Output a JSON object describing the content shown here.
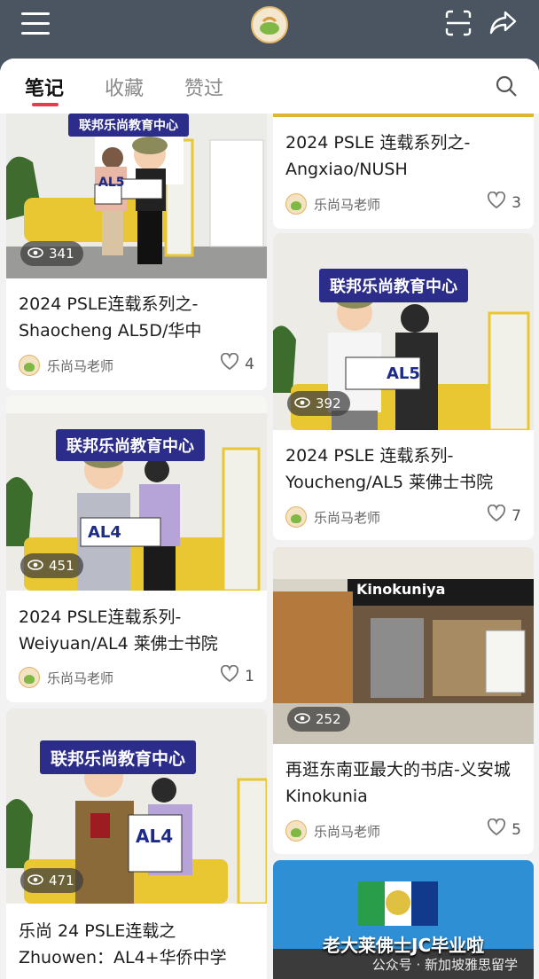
{
  "tabs": [
    "笔记",
    "收藏",
    "赞过"
  ],
  "banner_text": "联邦乐尚教育中心",
  "store_sign": "Kinokuniya",
  "promo_text": "老大莱佛士JC毕业啦",
  "watermark": "公众号 · 新加坡雅思留学",
  "author": "乐尚马老师",
  "cards": [
    {
      "views": "341",
      "title": "2024 PSLE连载系列之-\nShaocheng AL5D/华中",
      "likes": "4",
      "sign": "AL5"
    },
    {
      "views": "451",
      "title": "2024 PSLE连载系列-\nWeiyuan/AL4 莱佛士书院",
      "likes": "1",
      "sign": "AL4"
    },
    {
      "views": "471",
      "title": "乐尚 24 PSLE连载之\nZhuowen：AL4+华侨中学",
      "likes": "",
      "sign": "AL4"
    },
    {
      "views": "",
      "title": "2024 PSLE 连载系列之-\nAngxiao/NUSH",
      "likes": "3",
      "sign": ""
    },
    {
      "views": "392",
      "title": "2024 PSLE 连载系列-\nYoucheng/AL5 莱佛士书院",
      "likes": "7",
      "sign": "AL5"
    },
    {
      "views": "252",
      "title": "再逛东南亚最大的书店-义安城\nKinokunia",
      "likes": "5",
      "sign": ""
    }
  ],
  "colors": {
    "header": "#4a5561",
    "accent": "#e43d4f",
    "banner": "#2c2d8a",
    "sofa": "#e8c733"
  }
}
